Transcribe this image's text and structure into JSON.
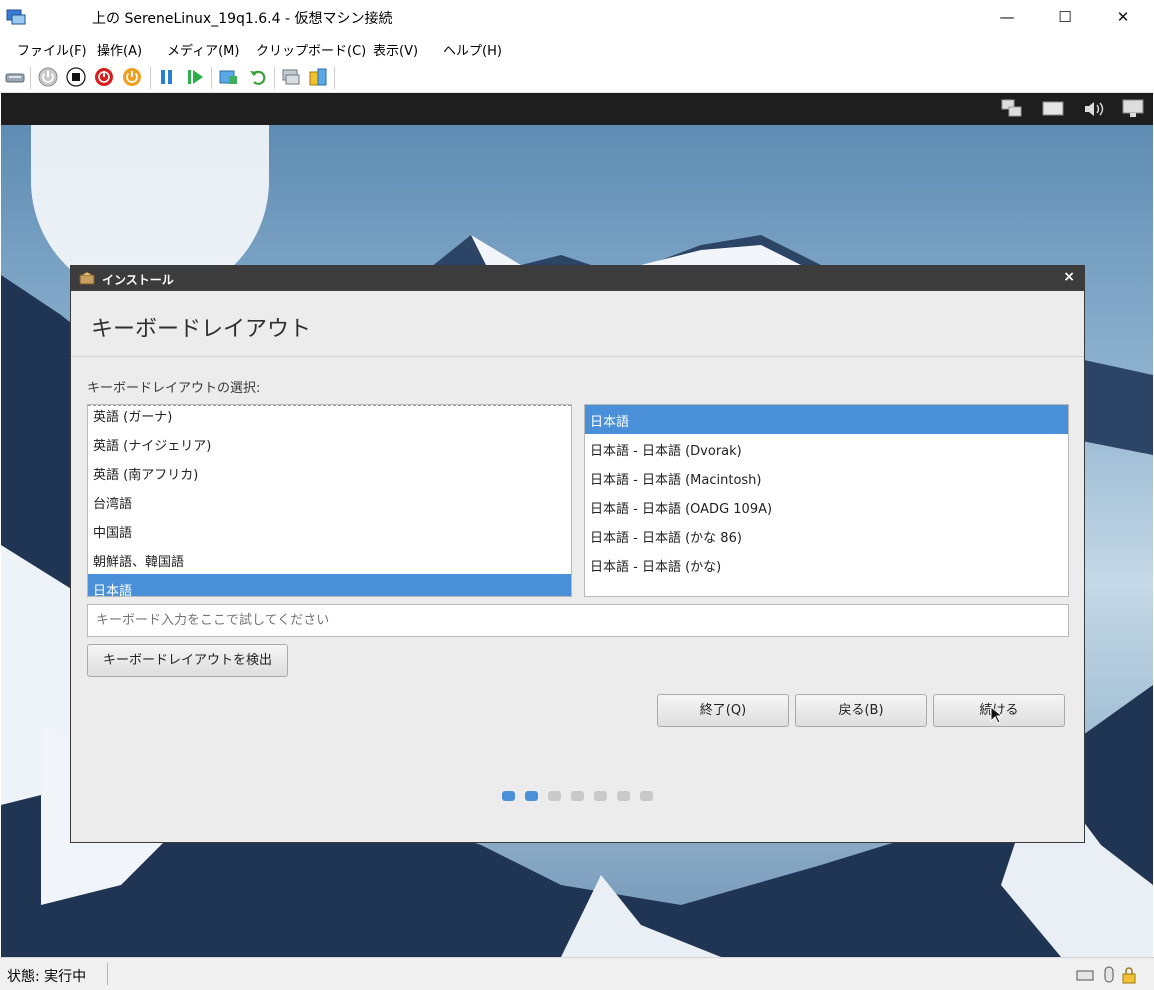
{
  "window": {
    "title": "上の SereneLinux_19q1.6.4  - 仮想マシン接続",
    "minimize_glyph": "—",
    "maximize_glyph": "☐",
    "close_glyph": "✕"
  },
  "menu": [
    "ファイル(F)",
    "操作(A)",
    "メディア(M)",
    "クリップボード(C)",
    "表示(V)",
    "ヘルプ(H)"
  ],
  "toolbar_icons": [
    "ctrl-alt-del-icon",
    "start-icon",
    "turn-off-icon",
    "shutdown-icon",
    "save-icon",
    "pause-icon",
    "resume-icon",
    "checkpoint-icon",
    "revert-icon",
    "enhanced-session-icon",
    "share-icon"
  ],
  "vm_indicators": [
    "network-icon",
    "display-icon",
    "volume-icon",
    "monitor-icon"
  ],
  "installer": {
    "window_title": "インストール",
    "close_glyph": "×",
    "page_title": "キーボードレイアウト",
    "section_label": "キーボードレイアウトの選択:",
    "left_list": [
      {
        "label": "英語 (ガーナ)",
        "selected": false
      },
      {
        "label": "英語 (ナイジェリア)",
        "selected": false
      },
      {
        "label": "英語 (南アフリカ)",
        "selected": false
      },
      {
        "label": "台湾語",
        "selected": false
      },
      {
        "label": "中国語",
        "selected": false
      },
      {
        "label": "朝鮮語、韓国語",
        "selected": false
      },
      {
        "label": "日本語",
        "selected": true
      }
    ],
    "right_list": [
      {
        "label": "日本語",
        "selected": true
      },
      {
        "label": "日本語 - 日本語 (Dvorak)",
        "selected": false
      },
      {
        "label": "日本語 - 日本語 (Macintosh)",
        "selected": false
      },
      {
        "label": "日本語 - 日本語 (OADG 109A)",
        "selected": false
      },
      {
        "label": "日本語 - 日本語 (かな 86)",
        "selected": false
      },
      {
        "label": "日本語 - 日本語 (かな)",
        "selected": false
      }
    ],
    "test_input_placeholder": "キーボード入力をここで試してください",
    "detect_button": "キーボードレイアウトを検出",
    "quit_button": "終了(Q)",
    "back_button": "戻る(B)",
    "continue_button": "続ける",
    "progress": {
      "total_steps": 7,
      "current_step": 2
    }
  },
  "statusbar": {
    "status": "状態: 実行中"
  },
  "colors": {
    "accent": "#4a90d9",
    "dialog_title": "#3c3c3c",
    "vm_topbar": "#1e1e1e"
  }
}
